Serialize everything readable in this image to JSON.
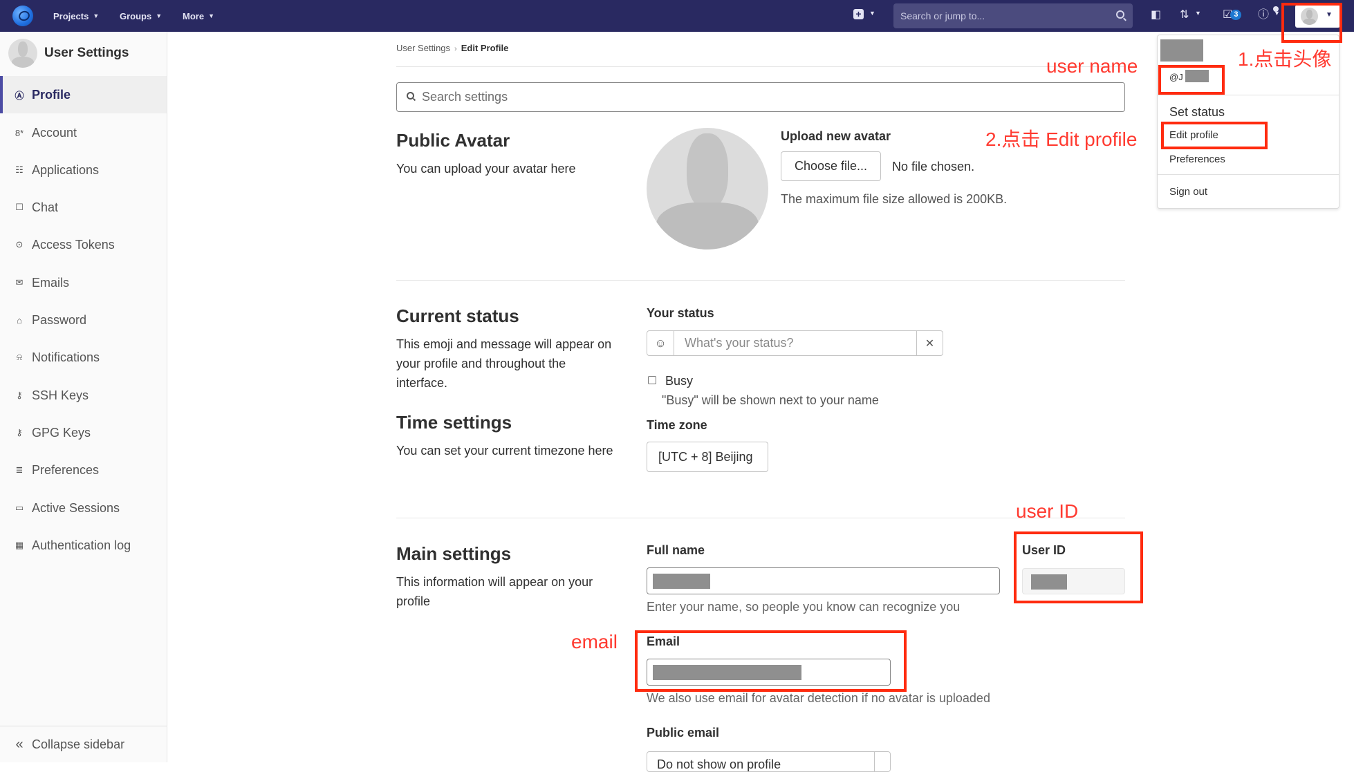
{
  "navbar": {
    "menus": [
      {
        "label": "Projects"
      },
      {
        "label": "Groups"
      },
      {
        "label": "More"
      }
    ],
    "search_placeholder": "Search or jump to...",
    "todo_count": "3",
    "icons": {
      "logo": "gitlab-logo-icon",
      "new": "plus-square-icon",
      "issues": "issues-icon",
      "merge_requests": "merge-request-icon",
      "todos": "todo-check-icon",
      "help": "question-circle-icon",
      "search": "search-icon"
    }
  },
  "sidebar": {
    "title": "User Settings",
    "items": [
      {
        "label": "Profile",
        "icon": "Ⓐ",
        "active": true
      },
      {
        "label": "Account",
        "icon": "8*"
      },
      {
        "label": "Applications",
        "icon": "☷"
      },
      {
        "label": "Chat",
        "icon": "☐"
      },
      {
        "label": "Access Tokens",
        "icon": "⊙"
      },
      {
        "label": "Emails",
        "icon": "✉"
      },
      {
        "label": "Password",
        "icon": "⌂"
      },
      {
        "label": "Notifications",
        "icon": "⍾"
      },
      {
        "label": "SSH Keys",
        "icon": "⚷"
      },
      {
        "label": "GPG Keys",
        "icon": "⚷"
      },
      {
        "label": "Preferences",
        "icon": "≣"
      },
      {
        "label": "Active Sessions",
        "icon": "▭"
      },
      {
        "label": "Authentication log",
        "icon": "▦"
      }
    ],
    "collapse_label": "Collapse sidebar",
    "collapse_icon": "«"
  },
  "breadcrumb": {
    "parent": "User Settings",
    "separator": "›",
    "current": "Edit Profile"
  },
  "search_settings": {
    "placeholder": "Search settings"
  },
  "public_avatar": {
    "title": "Public Avatar",
    "description": "You can upload your avatar here",
    "upload_label": "Upload new avatar",
    "choose_button": "Choose file...",
    "no_file": "No file chosen.",
    "max_size": "The maximum file size allowed is 200KB."
  },
  "current_status": {
    "title": "Current status",
    "description": "This emoji and message will appear on your profile and throughout the interface.",
    "your_status_label": "Your status",
    "status_placeholder": "What's your status?",
    "emoji_icon": "☺",
    "clear_icon": "✕",
    "busy_label": "Busy",
    "busy_checked": false,
    "busy_help": "\"Busy\" will be shown next to your name"
  },
  "time_settings": {
    "title": "Time settings",
    "description": "You can set your current timezone here",
    "timezone_label": "Time zone",
    "timezone_value": "[UTC + 8] Beijing"
  },
  "main_settings": {
    "title": "Main settings",
    "description": "This information will appear on your profile",
    "full_name_label": "Full name",
    "full_name_help": "Enter your name, so people you know can recognize you",
    "user_id_label": "User ID",
    "email_label": "Email",
    "email_help": "We also use email for avatar detection if no avatar is uploaded",
    "public_email_label": "Public email",
    "public_email_value": "Do not show on profile"
  },
  "user_dropdown": {
    "username_prefix": "@J",
    "items": [
      {
        "label": "Set status"
      },
      {
        "label": "Edit profile"
      },
      {
        "label": "Preferences"
      },
      {
        "label": "Sign out"
      }
    ]
  },
  "annotations": {
    "step1": "1.点击头像",
    "user_name": "user name",
    "step2": "2.点击 Edit profile",
    "user_id": "user ID",
    "email": "email"
  },
  "colors": {
    "navbar": "#292961",
    "accent": "#4b4ba3",
    "annotation": "#ff2b0f"
  }
}
